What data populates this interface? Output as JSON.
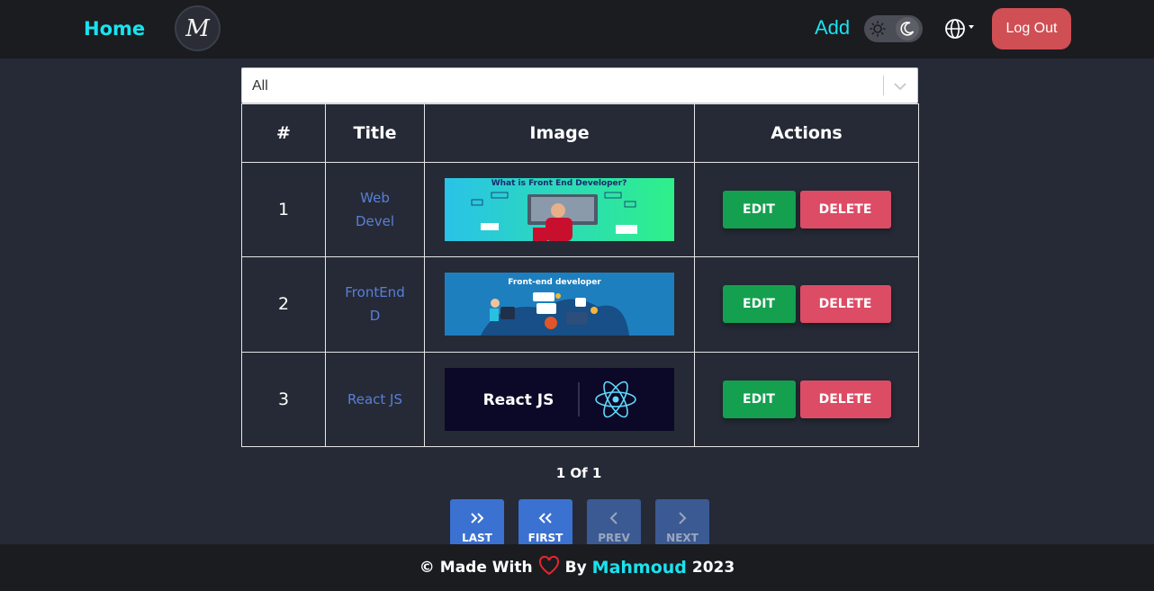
{
  "navbar": {
    "home_label": "Home",
    "logo_text": "M",
    "add_label": "Add",
    "logout_label": "Log Out",
    "accent_color": "#19e3f0",
    "logout_color": "#cf4f55",
    "icons": [
      "sun-icon",
      "moon-icon",
      "globe-icon"
    ]
  },
  "filter": {
    "selected": "All"
  },
  "table": {
    "headers": [
      "#",
      "Title",
      "Image",
      "Actions"
    ],
    "rows": [
      {
        "index": "1",
        "title": "Web Devel",
        "image": "What is Front End Developer?",
        "edit": "EDIT",
        "delete": "DELETE"
      },
      {
        "index": "2",
        "title": "FrontEnd D",
        "image": "Front-end developer",
        "edit": "EDIT",
        "delete": "DELETE"
      },
      {
        "index": "3",
        "title": "React JS",
        "image": "React JS",
        "edit": "EDIT",
        "delete": "DELETE"
      }
    ]
  },
  "pagination": {
    "info": "1 Of 1",
    "last": "LAST",
    "first": "FIRST",
    "prev": "PREV",
    "next": "NEXT"
  },
  "footer": {
    "copyright": "©",
    "made_with": "Made With",
    "by": "By",
    "author": "Mahmoud",
    "year": "2023"
  },
  "colors": {
    "background": "#252a36",
    "navbar": "#1b1c20",
    "edit": "#14a04f",
    "delete": "#dc4c65",
    "title_link": "#5a7fd8",
    "page_active": "#3b71d0",
    "page_disabled": "#3b5a93"
  }
}
